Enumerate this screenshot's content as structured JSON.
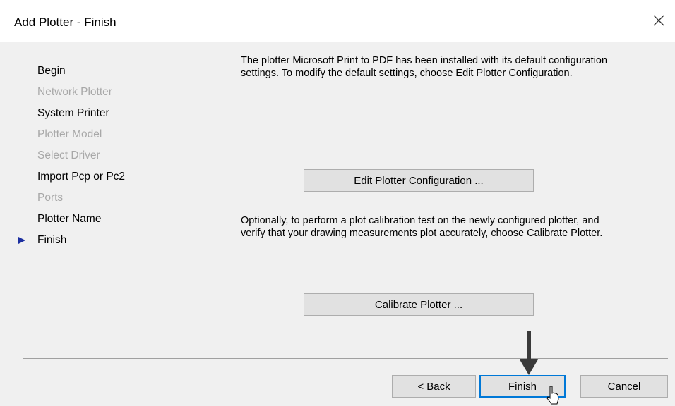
{
  "window": {
    "title": "Add Plotter - Finish",
    "close_icon": "close-icon"
  },
  "steps": [
    {
      "label": "Begin",
      "enabled": true,
      "current": false
    },
    {
      "label": "Network Plotter",
      "enabled": false,
      "current": false
    },
    {
      "label": "System Printer",
      "enabled": true,
      "current": false
    },
    {
      "label": "Plotter Model",
      "enabled": false,
      "current": false
    },
    {
      "label": "Select Driver",
      "enabled": false,
      "current": false
    },
    {
      "label": "Import Pcp or Pc2",
      "enabled": true,
      "current": false
    },
    {
      "label": "Ports",
      "enabled": false,
      "current": false
    },
    {
      "label": "Plotter Name",
      "enabled": true,
      "current": false
    },
    {
      "label": "Finish",
      "enabled": true,
      "current": true
    }
  ],
  "main": {
    "message_installed": "The plotter Microsoft Print to PDF has been installed with its default configuration settings.  To modify the default settings, choose Edit Plotter Configuration.",
    "edit_button_label": "Edit Plotter Configuration ...",
    "message_calibrate": "Optionally, to perform a plot calibration test on the newly configured plotter, and verify that your drawing measurements plot accurately, choose Calibrate Plotter.",
    "calibrate_button_label": "Calibrate Plotter ..."
  },
  "footer": {
    "back_label": "< Back",
    "finish_label": "Finish",
    "cancel_label": "Cancel"
  },
  "colors": {
    "current_step_marker": "#1c2fa0",
    "focus_border": "#0078d7",
    "disabled_text": "#a8a8a8"
  }
}
